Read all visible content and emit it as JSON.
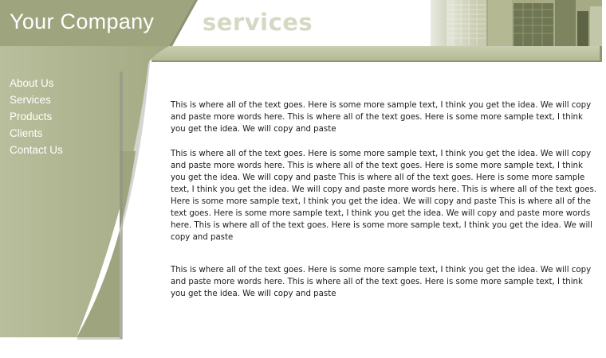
{
  "header": {
    "company_name": "Your Company",
    "page_heading": "services"
  },
  "nav": {
    "items": [
      {
        "label": "About Us"
      },
      {
        "label": "Services"
      },
      {
        "label": "Products"
      },
      {
        "label": "Clients"
      },
      {
        "label": "Contact Us"
      }
    ]
  },
  "content": {
    "paragraphs": [
      "This is where all of the text goes. Here is some more sample text, I think you get the idea. We will copy and paste more words here. This is where all of the text goes. Here is some more sample text, I think you get the idea. We will copy and paste",
      "This is where all of the text goes. Here is some more sample text, I think you get the idea. We will copy and paste more words here. This is where all of the text goes. Here is some more sample text, I think you get the idea. We will copy and paste This is where all of the text goes. Here is some more sample text, I think you get the idea. We will copy and paste more words here. This is where all of the text goes. Here is some more sample text, I think you get the idea. We will copy and paste This is where all of the text goes. Here is some more sample text, I think you get the idea. We will copy and paste more words here. This is where all of the text goes. Here is some more sample text, I think you get the idea. We will copy and paste",
      "This is where all of the text goes. Here is some more sample text, I think you get the idea. We will copy and paste more words here. This is where all of the text goes. Here is some more sample text, I think you get the idea. We will copy and paste"
    ]
  },
  "colors": {
    "olive_dark": "#9ea57e",
    "olive_light": "#bec3a2",
    "heading_light": "#d6d8c4",
    "text": "#1a1a1a"
  }
}
